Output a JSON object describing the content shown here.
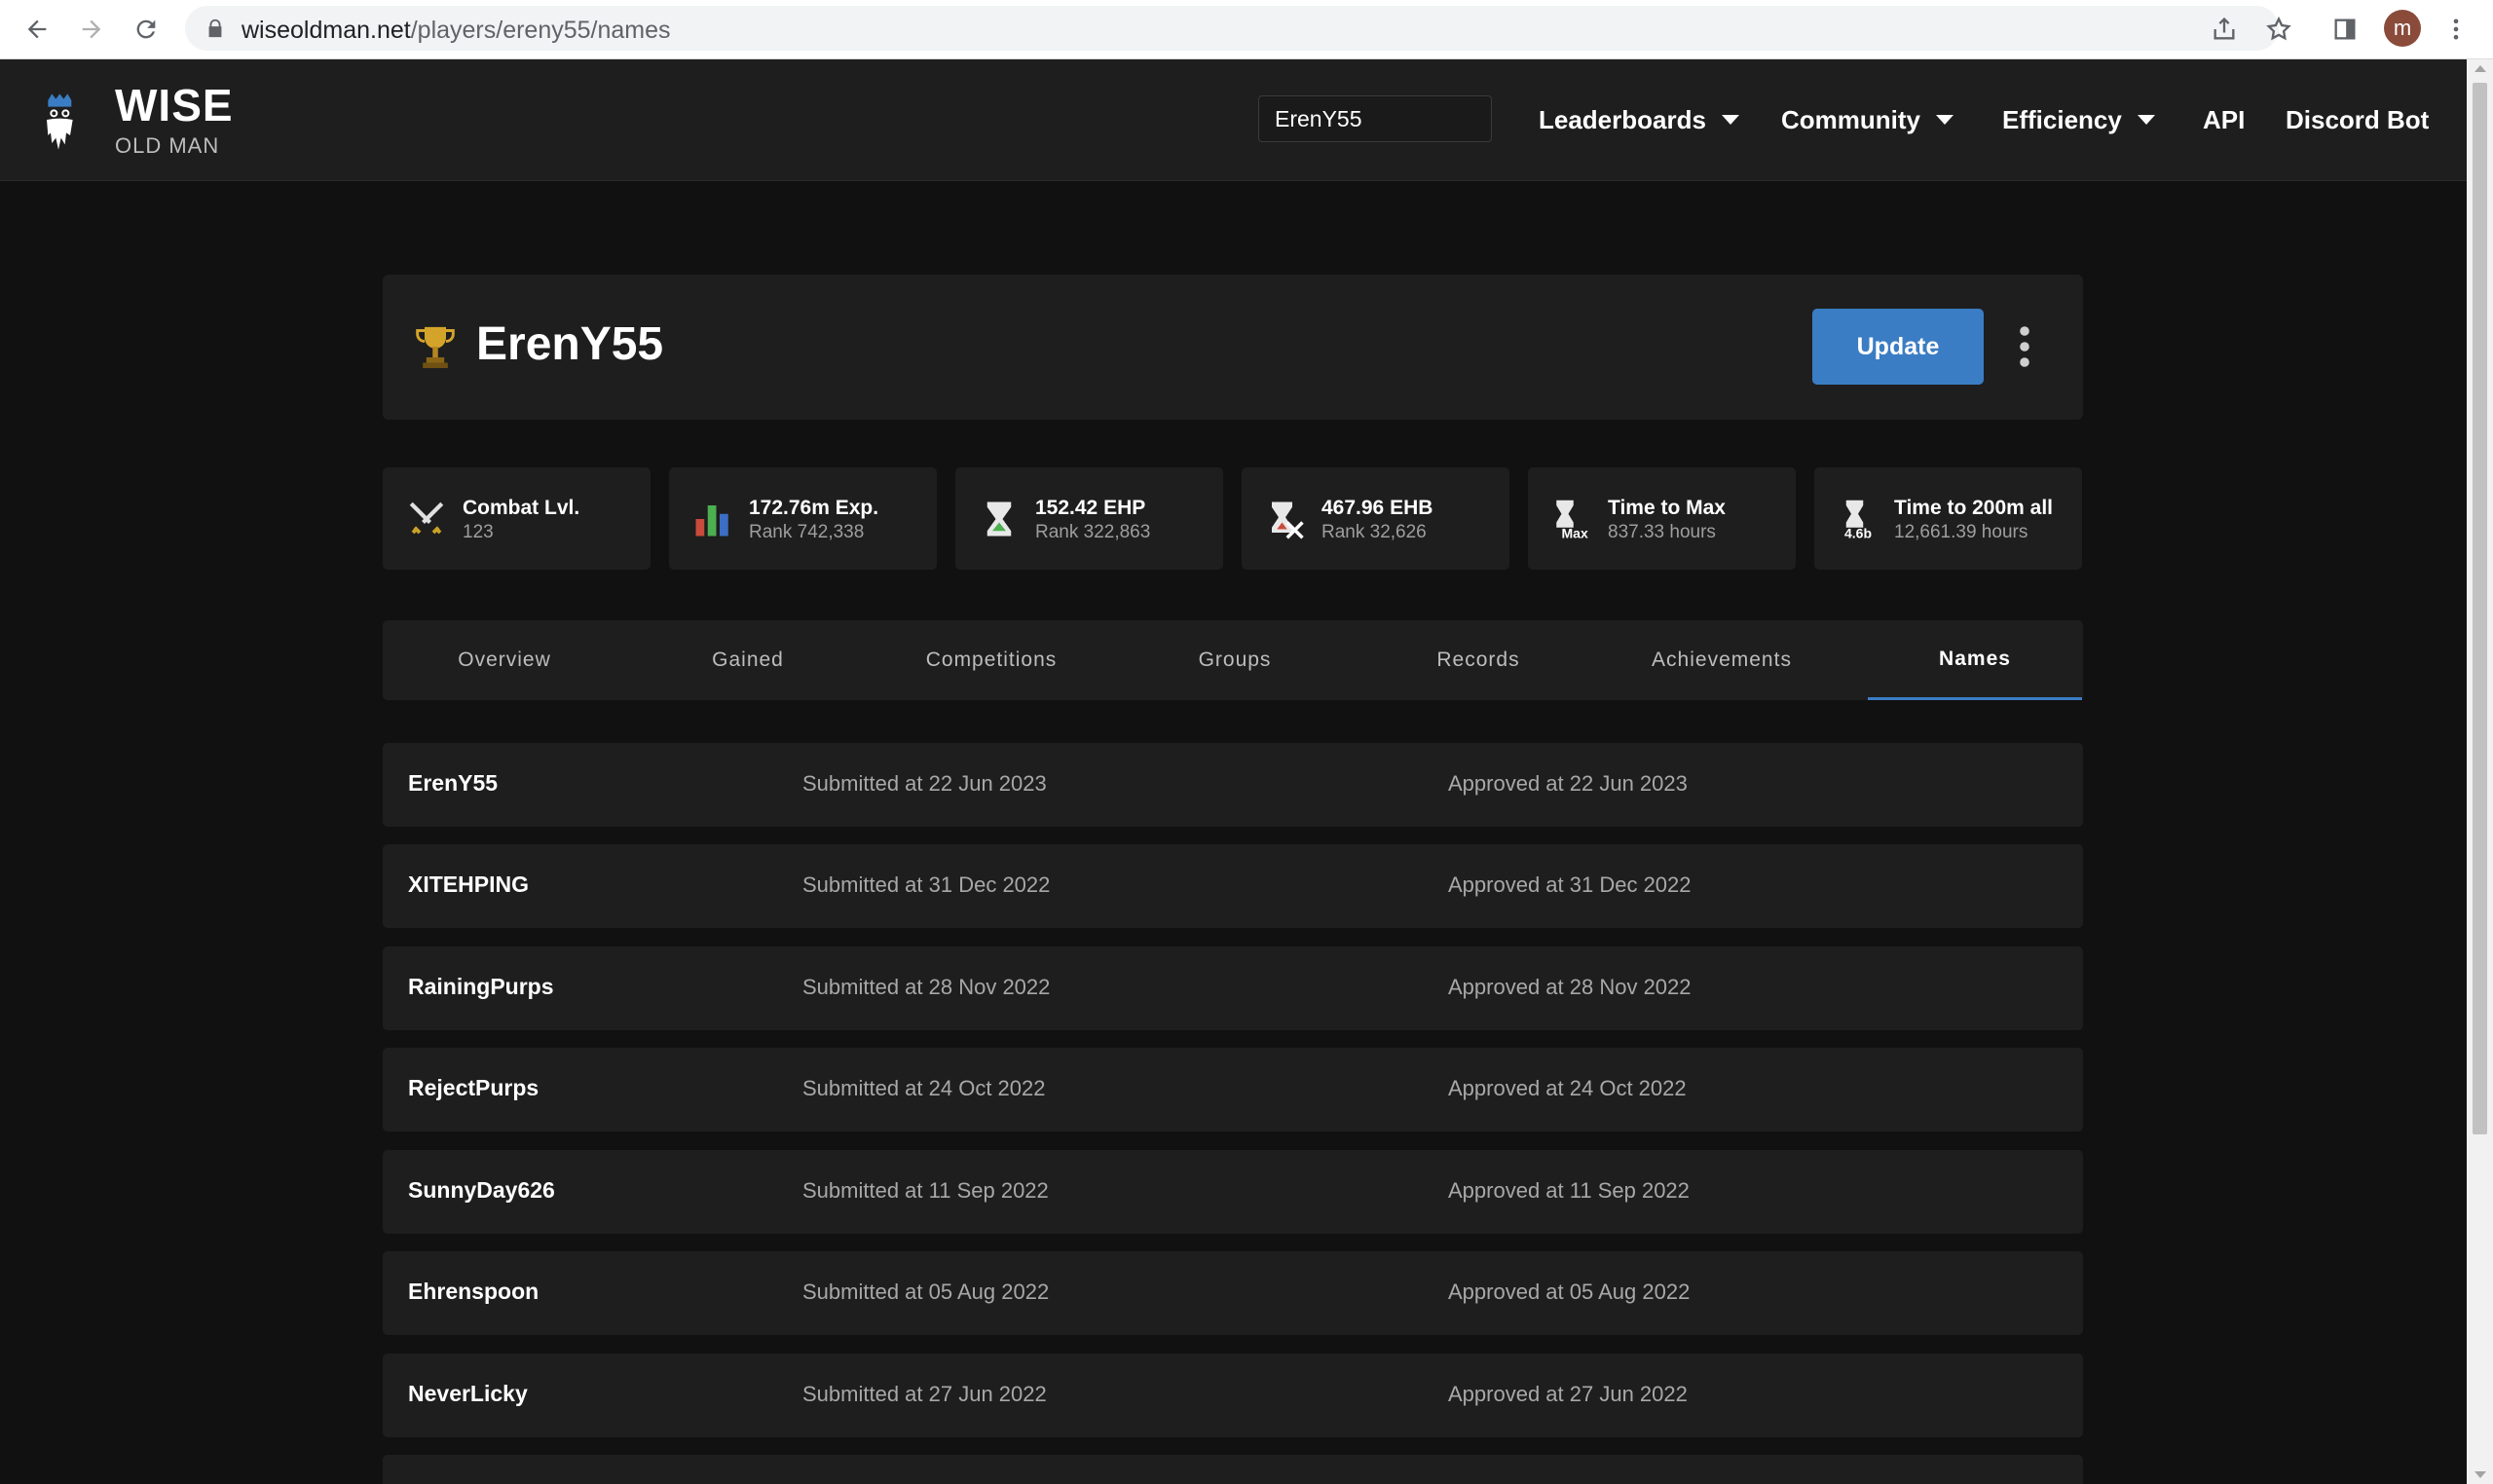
{
  "browser": {
    "url_host": "wiseoldman.net",
    "url_path": "/players/ereny55/names",
    "profile_initial": "m"
  },
  "header": {
    "logo_top": "WISE",
    "logo_bottom": "OLD MAN",
    "search_value": "ErenY55",
    "menu": [
      {
        "label": "Leaderboards",
        "has_caret": true
      },
      {
        "label": "Community",
        "has_caret": true
      },
      {
        "label": "Efficiency",
        "has_caret": true
      },
      {
        "label": "API",
        "has_caret": false
      },
      {
        "label": "Discord Bot",
        "has_caret": false
      }
    ]
  },
  "player": {
    "name": "ErenY55",
    "update_label": "Update"
  },
  "stats": [
    {
      "label": "Combat Lvl.",
      "value": "123",
      "icon": "crossed-swords-icon"
    },
    {
      "label": "172.76m Exp.",
      "value": "Rank 742,338",
      "icon": "bar-chart-icon"
    },
    {
      "label": "152.42 EHP",
      "value": "Rank 322,863",
      "icon": "hourglass-icon"
    },
    {
      "label": "467.96 EHB",
      "value": "Rank 32,626",
      "icon": "hourglass-sword-icon"
    },
    {
      "label": "Time to Max",
      "value": "837.33 hours",
      "icon": "hourglass-max-icon",
      "badge": "Max"
    },
    {
      "label": "Time to 200m all",
      "value": "12,661.39 hours",
      "icon": "hourglass-4.6b-icon",
      "badge": "4.6b"
    }
  ],
  "tabs": [
    {
      "label": "Overview"
    },
    {
      "label": "Gained"
    },
    {
      "label": "Competitions"
    },
    {
      "label": "Groups"
    },
    {
      "label": "Records"
    },
    {
      "label": "Achievements"
    },
    {
      "label": "Names",
      "active": true
    }
  ],
  "names": [
    {
      "name": "ErenY55",
      "submitted": "Submitted at 22 Jun 2023",
      "approved": "Approved at 22 Jun 2023"
    },
    {
      "name": "XITEHPING",
      "submitted": "Submitted at 31 Dec 2022",
      "approved": "Approved at 31 Dec 2022"
    },
    {
      "name": "RainingPurps",
      "submitted": "Submitted at 28 Nov 2022",
      "approved": "Approved at 28 Nov 2022"
    },
    {
      "name": "RejectPurps",
      "submitted": "Submitted at 24 Oct 2022",
      "approved": "Approved at 24 Oct 2022"
    },
    {
      "name": "SunnyDay626",
      "submitted": "Submitted at 11 Sep 2022",
      "approved": "Approved at 11 Sep 2022"
    },
    {
      "name": "Ehrenspoon",
      "submitted": "Submitted at 05 Aug 2022",
      "approved": "Approved at 05 Aug 2022"
    },
    {
      "name": "NeverLicky",
      "submitted": "Submitted at 27 Jun 2022",
      "approved": "Approved at 27 Jun 2022"
    }
  ],
  "colors": {
    "accent": "#3b7dc4",
    "background": "#111111",
    "card": "#1e1e1e"
  }
}
